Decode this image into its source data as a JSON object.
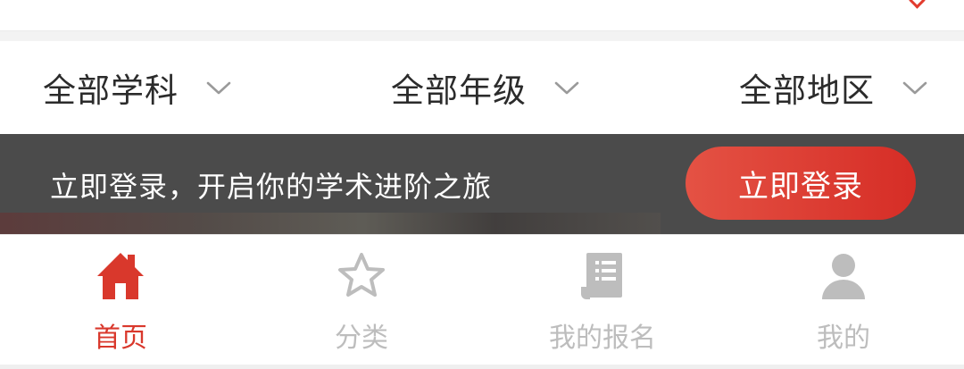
{
  "filters": [
    {
      "label": "全部学科",
      "icon": "chevron-down-icon"
    },
    {
      "label": "全部年级",
      "icon": "chevron-down-icon"
    },
    {
      "label": "全部地区",
      "icon": "chevron-down-icon"
    }
  ],
  "login_banner": {
    "text": "立即登录，开启你的学术进阶之旅",
    "button_label": "立即登录"
  },
  "tabs": [
    {
      "label": "首页",
      "icon": "home-icon",
      "active": true
    },
    {
      "label": "分类",
      "icon": "star-icon",
      "active": false
    },
    {
      "label": "我的报名",
      "icon": "document-icon",
      "active": false
    },
    {
      "label": "我的",
      "icon": "user-icon",
      "active": false
    }
  ],
  "colors": {
    "accent": "#d9382c",
    "inactive": "#bdbdbd",
    "banner_bg": "#4b4b4b",
    "text": "#2b2b2b"
  }
}
